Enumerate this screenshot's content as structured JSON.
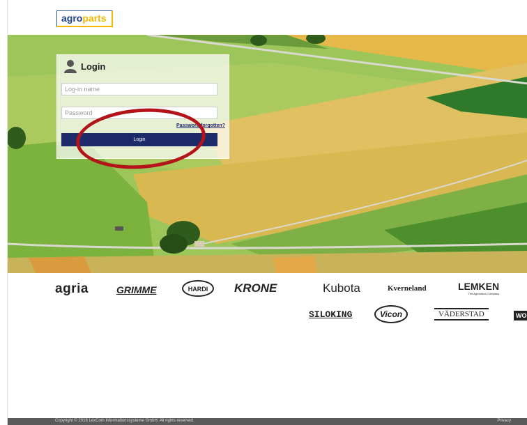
{
  "header": {
    "logo_part1": "agro",
    "logo_part2": "parts"
  },
  "login": {
    "title": "Login",
    "username_placeholder": "Log-in name",
    "password_placeholder": "Password",
    "forgot_label": "Password forgotten?",
    "button_label": "Login"
  },
  "brands": {
    "row1": [
      "agria",
      "GRIMME",
      "HARDI",
      "KRONE",
      "Kubota",
      "Kverneland",
      "LEMKEN"
    ],
    "lemken_tagline": "The Agrovision Company",
    "row2": [
      "SILOKING",
      "Vicon",
      "VÄDERSTAD",
      "WO"
    ]
  },
  "footer": {
    "copyright": "Copyright © 2018 LexCom Informationssysteme GmbH. All rights reserved.",
    "privacy": "Privacy"
  },
  "colors": {
    "primary": "#1d2b6b",
    "logo_blue": "#1d3f8f",
    "logo_yellow": "#f5b800",
    "annotation": "#b3141a"
  }
}
